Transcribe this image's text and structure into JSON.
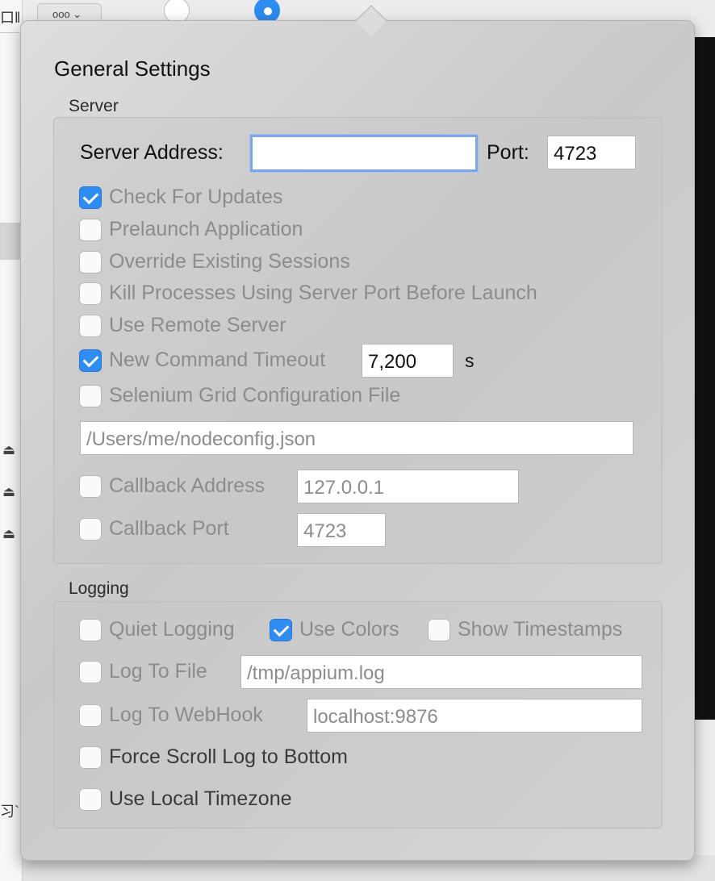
{
  "background": {
    "left_fragment": "口‖",
    "bottom_fragment": "习`",
    "toolbar_button_label": "ooo ⌄"
  },
  "panel": {
    "title": "General Settings",
    "server": {
      "section_label": "Server",
      "server_address_label": "Server Address:",
      "server_address_value": "",
      "port_label": "Port:",
      "port_value": "4723",
      "check_for_updates": {
        "label": "Check For Updates",
        "checked": true
      },
      "prelaunch_application": {
        "label": "Prelaunch Application",
        "checked": false
      },
      "override_sessions": {
        "label": "Override Existing Sessions",
        "checked": false
      },
      "kill_processes": {
        "label": "Kill Processes Using Server Port Before Launch",
        "checked": false
      },
      "use_remote_server": {
        "label": "Use Remote Server",
        "checked": false
      },
      "new_command_timeout": {
        "label": "New Command Timeout",
        "checked": true,
        "value": "7,200",
        "unit": "s"
      },
      "selenium_grid": {
        "label": "Selenium Grid Configuration File",
        "checked": false,
        "path": "/Users/me/nodeconfig.json"
      },
      "callback_address": {
        "label": "Callback Address",
        "checked": false,
        "value": "127.0.0.1"
      },
      "callback_port": {
        "label": "Callback Port",
        "checked": false,
        "value": "4723"
      }
    },
    "logging": {
      "section_label": "Logging",
      "quiet_logging": {
        "label": "Quiet Logging",
        "checked": false
      },
      "use_colors": {
        "label": "Use Colors",
        "checked": true
      },
      "show_timestamps": {
        "label": "Show Timestamps",
        "checked": false
      },
      "log_to_file": {
        "label": "Log To File",
        "checked": false,
        "value": "/tmp/appium.log"
      },
      "log_to_webhook": {
        "label": "Log To WebHook",
        "checked": false,
        "value": "localhost:9876"
      },
      "force_scroll": {
        "label": "Force Scroll Log to Bottom",
        "checked": false
      },
      "local_timezone": {
        "label": "Use Local Timezone",
        "checked": false
      }
    }
  },
  "colors": {
    "accent": "#2f8cf3",
    "focus_ring": "#7ea7e2"
  }
}
